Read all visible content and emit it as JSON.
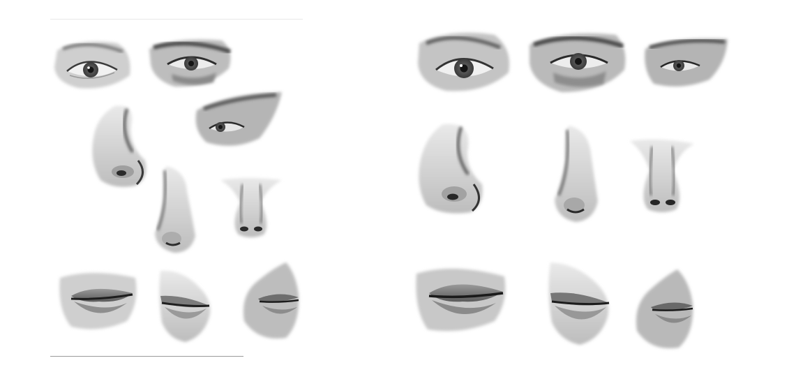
{
  "image": {
    "subject": "facial-feature-studies",
    "palette": {
      "paper": "#ffffff",
      "shadow": "#3a3a3a",
      "mid": "#8c8c8c",
      "light": "#d6d6d6"
    }
  },
  "panels": [
    {
      "id": "left",
      "studies": [
        {
          "kind": "eye",
          "view": "front"
        },
        {
          "kind": "eye",
          "view": "front"
        },
        {
          "kind": "eye",
          "view": "three-quarter"
        },
        {
          "kind": "nose",
          "view": "three-quarter"
        },
        {
          "kind": "nose",
          "view": "profile"
        },
        {
          "kind": "nose",
          "view": "front"
        },
        {
          "kind": "mouth",
          "view": "three-quarter"
        },
        {
          "kind": "mouth",
          "view": "profile"
        },
        {
          "kind": "mouth",
          "view": "profile"
        }
      ]
    },
    {
      "id": "right",
      "studies": [
        {
          "kind": "eye",
          "view": "front"
        },
        {
          "kind": "eye",
          "view": "front"
        },
        {
          "kind": "eye",
          "view": "three-quarter"
        },
        {
          "kind": "nose",
          "view": "three-quarter"
        },
        {
          "kind": "nose",
          "view": "profile"
        },
        {
          "kind": "nose",
          "view": "front"
        },
        {
          "kind": "mouth",
          "view": "three-quarter"
        },
        {
          "kind": "mouth",
          "view": "profile"
        },
        {
          "kind": "mouth",
          "view": "profile"
        }
      ]
    }
  ]
}
